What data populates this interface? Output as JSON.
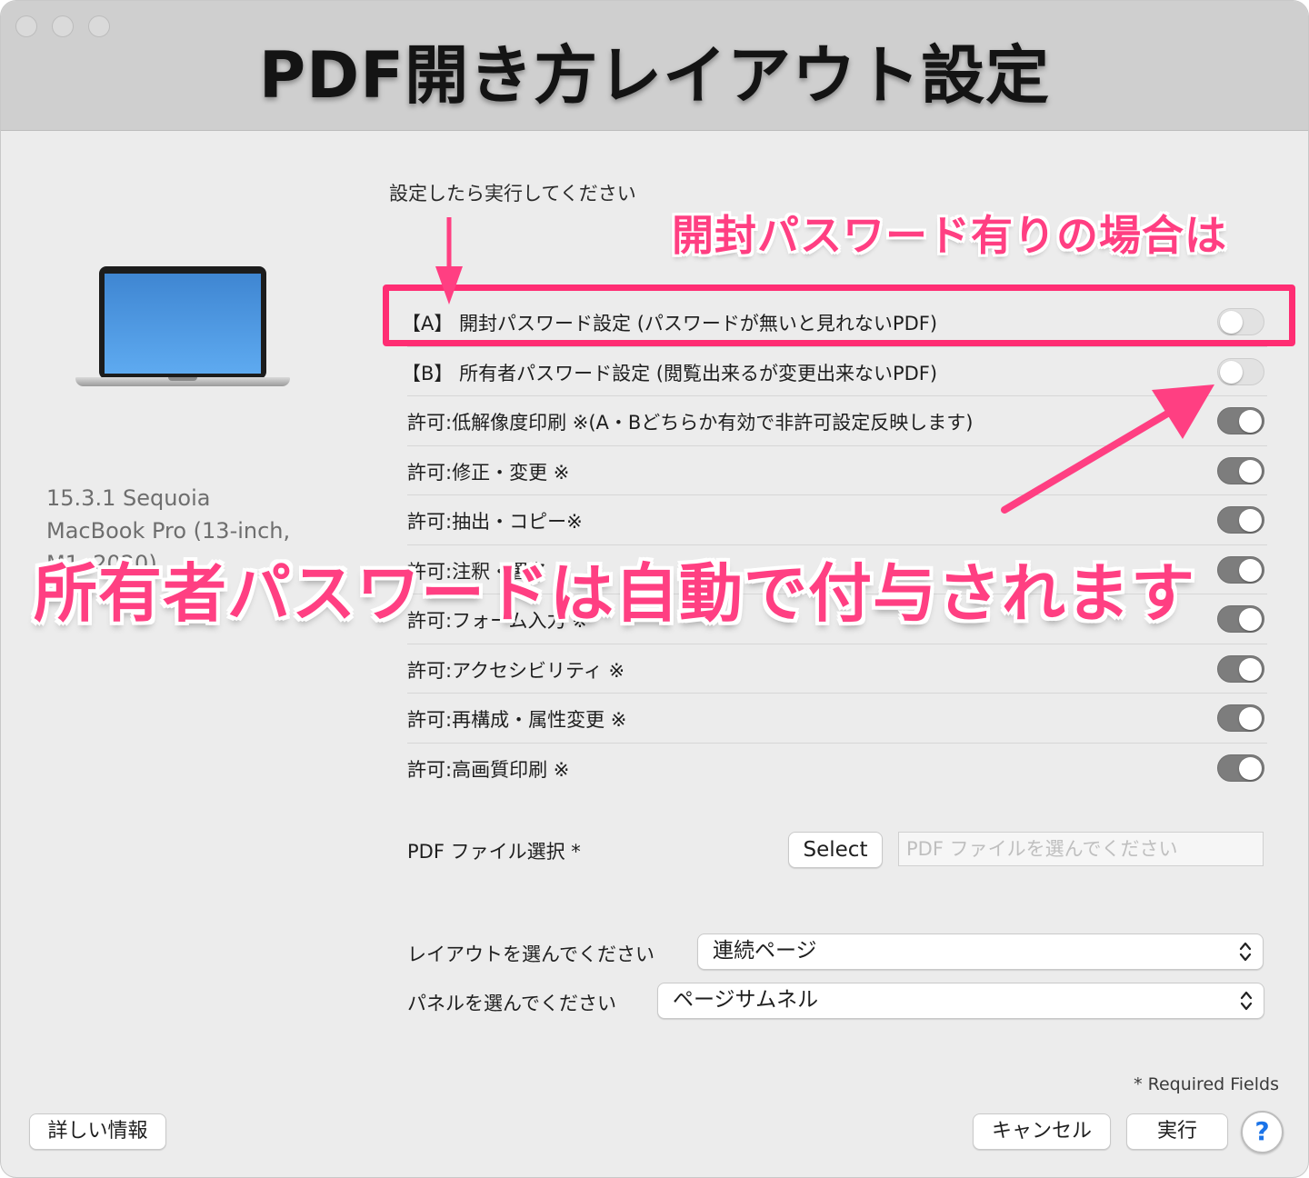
{
  "window": {
    "title": "PDF開き方レイアウト設定"
  },
  "left_panel": {
    "os_version": "15.3.1 Sequoia",
    "model": "MacBook Pro (13-inch,",
    "model_detail": "M1, 2020)"
  },
  "instruction": "設定したら実行してください",
  "annotations": {
    "top_callout": "開封パスワード有りの場合は",
    "main_callout": "所有者パスワードは自動で付与されます",
    "color": "#ff3f82"
  },
  "rows": [
    {
      "label": "【A】 開封パスワード設定 (パスワードが無いと見れないPDF)",
      "state": "off"
    },
    {
      "label": "【B】 所有者パスワード設定 (閲覧出来るが変更出来ないPDF)",
      "state": "off"
    },
    {
      "label": "許可:低解像度印刷 ※(A・Bどちらか有効で非許可設定反映します)",
      "state": "on"
    },
    {
      "label": "許可:修正・変更 ※",
      "state": "on"
    },
    {
      "label": "許可:抽出・コピー※",
      "state": "on"
    },
    {
      "label": "許可:注釈・署名 ※",
      "state": "on"
    },
    {
      "label": "許可:フォーム入力 ※",
      "state": "on"
    },
    {
      "label": "許可:アクセシビリティ ※",
      "state": "on"
    },
    {
      "label": "許可:再構成・属性変更 ※",
      "state": "on"
    },
    {
      "label": "許可:高画質印刷 ※",
      "state": "on"
    }
  ],
  "file_select": {
    "label": "PDF ファイル選択 *",
    "button": "Select",
    "placeholder": "PDF ファイルを選んでください"
  },
  "layout_select": {
    "label": "レイアウトを選んでください",
    "value": "連続ページ"
  },
  "panel_select": {
    "label": "パネルを選んでください",
    "value": "ページサムネル"
  },
  "required_note": "* Required Fields",
  "buttons": {
    "info": "詳しい情報",
    "cancel": "キャンセル",
    "run": "実行",
    "help": "?"
  }
}
